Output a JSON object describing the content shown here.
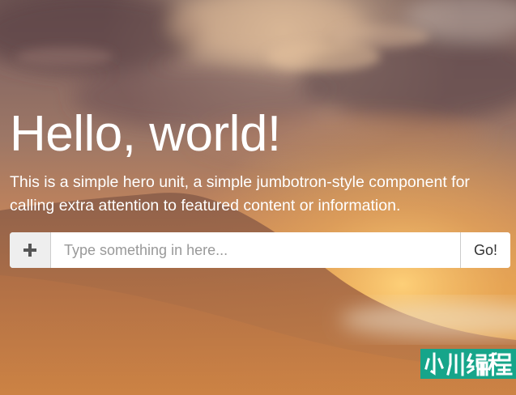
{
  "hero": {
    "title": "Hello, world!",
    "lead": "This is a simple hero unit, a simple jumbotron-style component for calling extra attention to featured content or information."
  },
  "input_group": {
    "addon_icon": "plus-icon",
    "placeholder": "Type something in here...",
    "value": "",
    "button_label": "Go!"
  },
  "watermark": {
    "text": "小川编程"
  },
  "colors": {
    "text": "#ffffff",
    "watermark_bg": "#16a58a",
    "addon_bg": "#eeeeee",
    "border": "#cccccc"
  }
}
